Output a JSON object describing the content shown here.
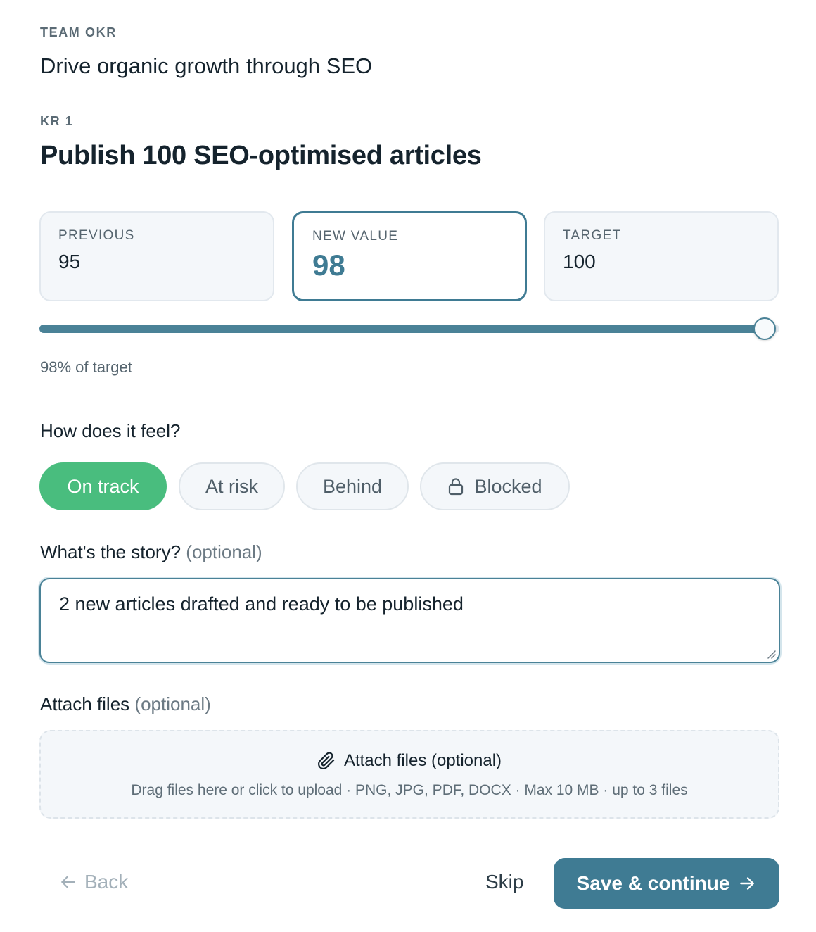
{
  "header": {
    "team_eyebrow": "TEAM OKR",
    "objective": "Drive organic growth through SEO",
    "kr_eyebrow": "KR 1",
    "kr_title": "Publish 100 SEO-optimised articles"
  },
  "stats": {
    "previous_label": "PREVIOUS",
    "previous_value": "95",
    "new_label": "NEW VALUE",
    "new_value": "98",
    "target_label": "TARGET",
    "target_value": "100"
  },
  "progress": {
    "fraction": 0.98,
    "text": "98% of target"
  },
  "feel": {
    "label": "How does it feel?",
    "options": [
      "On track",
      "At risk",
      "Behind",
      "Blocked"
    ],
    "selected": "On track"
  },
  "story": {
    "label": "What's the story?",
    "optional": "(optional)",
    "value": "2 new articles drafted and ready to be published"
  },
  "attach": {
    "label": "Attach files",
    "optional": "(optional)",
    "drop_title": "Attach files (optional)",
    "drop_hint": "Drag files here or click to upload · PNG, JPG, PDF, DOCX · Max 10 MB · up to 3 files"
  },
  "footer": {
    "back": "Back",
    "skip": "Skip",
    "save": "Save & continue"
  },
  "colors": {
    "accent": "#3f7b93",
    "on_track": "#49bd7e"
  },
  "icons": {
    "lock": "lock-icon",
    "paperclip": "paperclip-icon",
    "back": "arrow-left-icon",
    "save": "arrow-right-icon"
  }
}
